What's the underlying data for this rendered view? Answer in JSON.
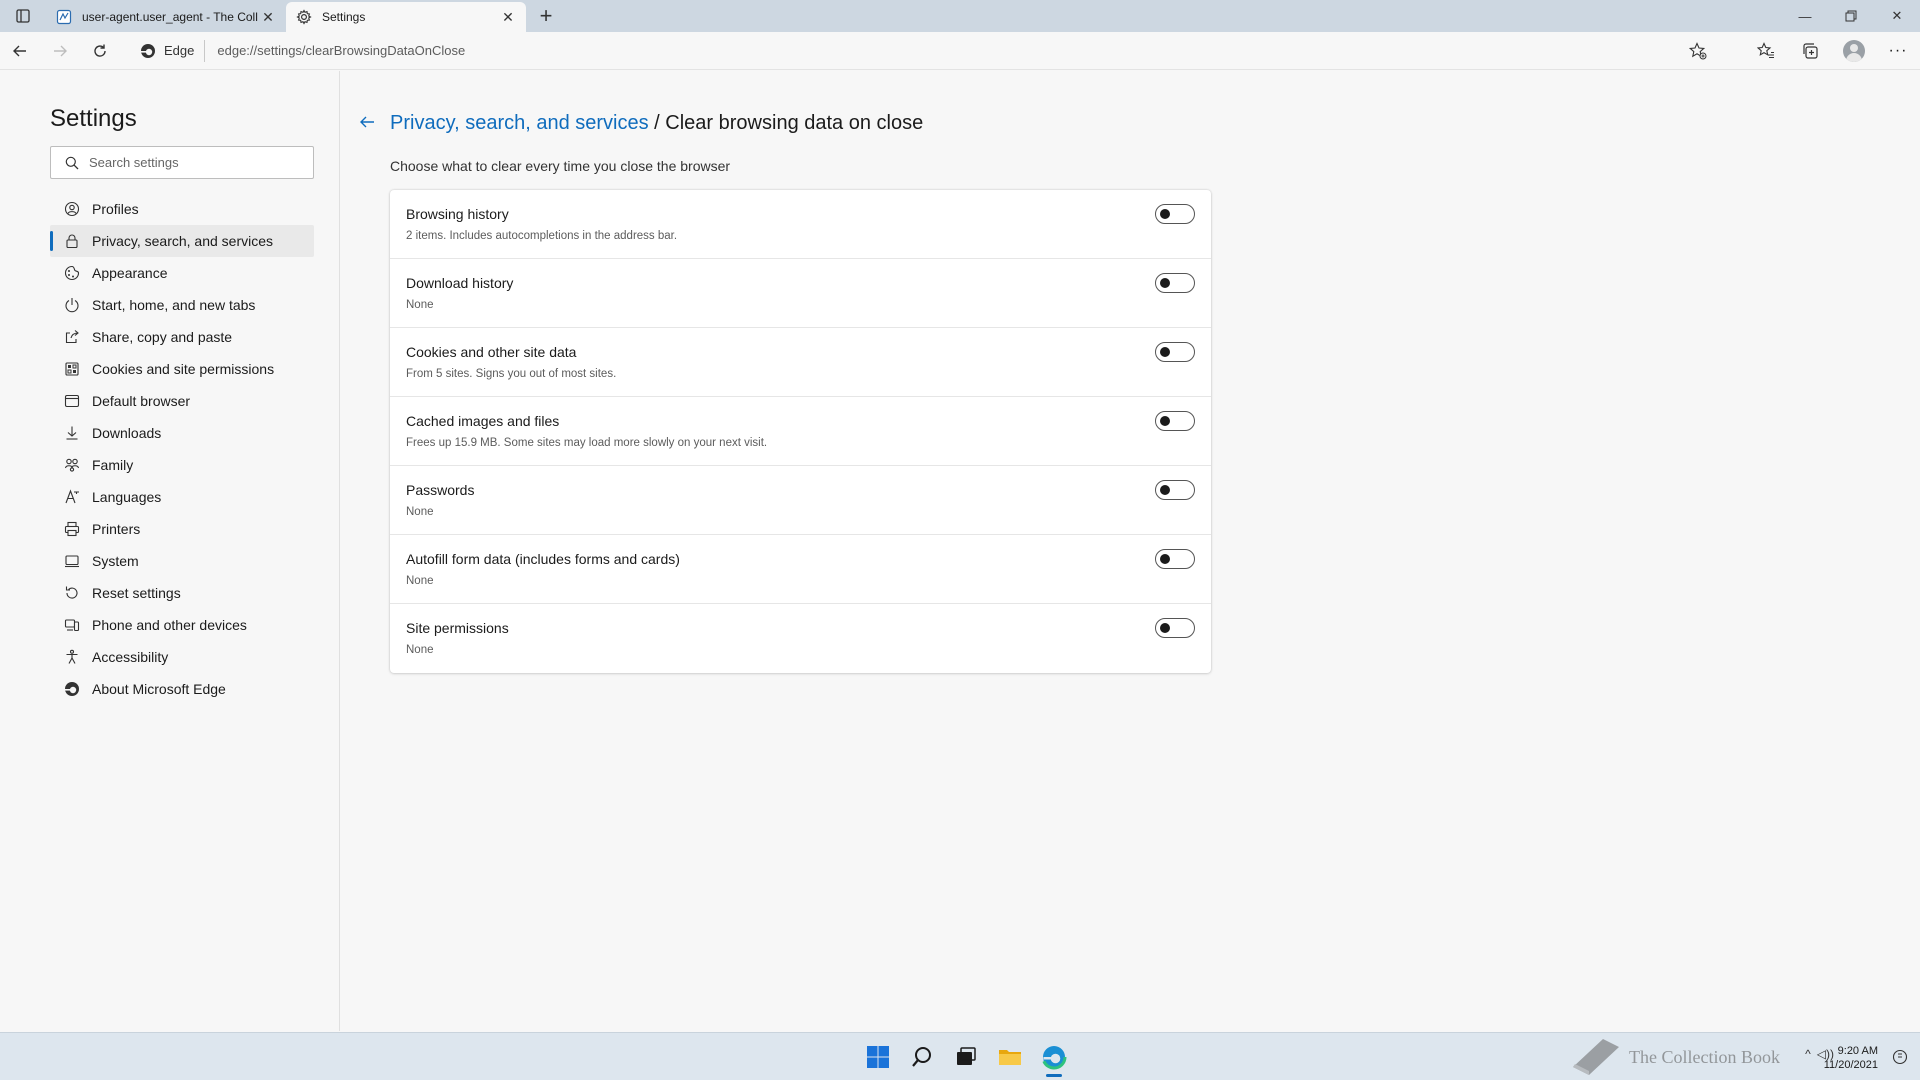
{
  "browser": {
    "tabs": [
      {
        "title": "user-agent.user_agent - The Coll",
        "active": false
      },
      {
        "title": "Settings",
        "active": true
      }
    ],
    "site_chip": "Edge",
    "url": "edge://settings/clearBrowsingDataOnClose"
  },
  "sidebar": {
    "title": "Settings",
    "search_placeholder": "Search settings",
    "items": [
      {
        "label": "Profiles",
        "icon": "profile-icon"
      },
      {
        "label": "Privacy, search, and services",
        "icon": "lock-icon",
        "selected": true
      },
      {
        "label": "Appearance",
        "icon": "appearance-icon"
      },
      {
        "label": "Start, home, and new tabs",
        "icon": "power-icon"
      },
      {
        "label": "Share, copy and paste",
        "icon": "share-icon"
      },
      {
        "label": "Cookies and site permissions",
        "icon": "cookies-icon"
      },
      {
        "label": "Default browser",
        "icon": "browser-icon"
      },
      {
        "label": "Downloads",
        "icon": "download-icon"
      },
      {
        "label": "Family",
        "icon": "family-icon"
      },
      {
        "label": "Languages",
        "icon": "languages-icon"
      },
      {
        "label": "Printers",
        "icon": "printer-icon"
      },
      {
        "label": "System",
        "icon": "system-icon"
      },
      {
        "label": "Reset settings",
        "icon": "reset-icon"
      },
      {
        "label": "Phone and other devices",
        "icon": "phone-icon"
      },
      {
        "label": "Accessibility",
        "icon": "accessibility-icon"
      },
      {
        "label": "About Microsoft Edge",
        "icon": "edge-icon"
      }
    ]
  },
  "main": {
    "breadcrumb_link": "Privacy, search, and services",
    "breadcrumb_sep": " / ",
    "breadcrumb_current": "Clear browsing data on close",
    "subtitle": "Choose what to clear every time you close the browser",
    "options": [
      {
        "title": "Browsing history",
        "desc": "2 items. Includes autocompletions in the address bar.",
        "enabled": false
      },
      {
        "title": "Download history",
        "desc": "None",
        "enabled": false
      },
      {
        "title": "Cookies and other site data",
        "desc": "From 5 sites. Signs you out of most sites.",
        "enabled": false
      },
      {
        "title": "Cached images and files",
        "desc": "Frees up 15.9 MB. Some sites may load more slowly on your next visit.",
        "enabled": false
      },
      {
        "title": "Passwords",
        "desc": "None",
        "enabled": false
      },
      {
        "title": "Autofill form data (includes forms and cards)",
        "desc": "None",
        "enabled": false
      },
      {
        "title": "Site permissions",
        "desc": "None",
        "enabled": false
      }
    ]
  },
  "taskbar": {
    "watermark": "The Collection Book",
    "time": "9:20 AM",
    "date": "11/20/2021"
  },
  "colors": {
    "accent": "#0f6cbd",
    "tabstrip": "#cdd7e1",
    "page_bg": "#f7f7f7",
    "taskbar": "#dde6ee"
  }
}
